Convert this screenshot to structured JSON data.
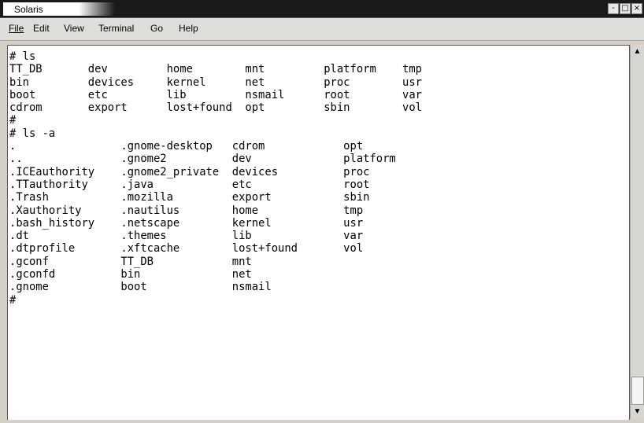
{
  "window": {
    "title": "Solaris"
  },
  "window_buttons": [
    "-",
    "□",
    "×"
  ],
  "menu": {
    "file": "File",
    "edit": "Edit",
    "view": "View",
    "terminal": "Terminal",
    "go": "Go",
    "help": "Help"
  },
  "terminal": {
    "lines": [
      "# ls",
      "TT_DB       dev         home        mnt         platform    tmp",
      "bin         devices     kernel      net         proc        usr",
      "boot        etc         lib         nsmail      root        var",
      "cdrom       export      lost+found  opt         sbin        vol",
      "#",
      "# ls -a",
      ".                .gnome-desktop   cdrom            opt",
      "..               .gnome2          dev              platform",
      ".ICEauthority    .gnome2_private  devices          proc",
      ".TTauthority     .java            etc              root",
      ".Trash           .mozilla         export           sbin",
      ".Xauthority      .nautilus        home             tmp",
      ".bash_history    .netscape        kernel           usr",
      ".dt              .themes          lib              var",
      ".dtprofile       .xftcache        lost+found       vol",
      ".gconf           TT_DB            mnt",
      ".gconfd          bin              net",
      ".gnome           boot             nsmail",
      "#"
    ]
  },
  "scrollbar": {
    "up_icon": "▲",
    "down_icon": "▼",
    "position": 1.0
  }
}
